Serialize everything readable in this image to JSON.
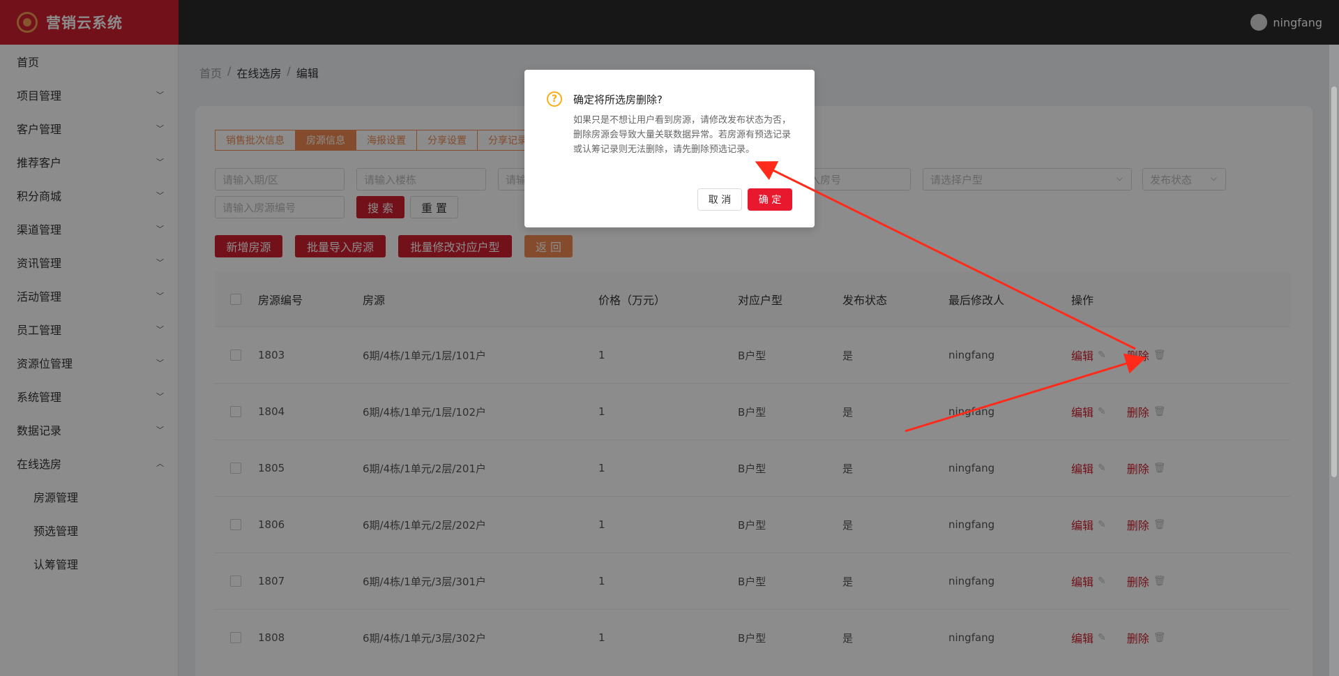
{
  "app": {
    "logo_text": "营销云系统",
    "username": "ningfang"
  },
  "sidebar": {
    "items": [
      {
        "label": "首页",
        "expandable": false
      },
      {
        "label": "项目管理",
        "expandable": true
      },
      {
        "label": "客户管理",
        "expandable": true
      },
      {
        "label": "推荐客户",
        "expandable": true
      },
      {
        "label": "积分商城",
        "expandable": true
      },
      {
        "label": "渠道管理",
        "expandable": true
      },
      {
        "label": "资讯管理",
        "expandable": true
      },
      {
        "label": "活动管理",
        "expandable": true
      },
      {
        "label": "员工管理",
        "expandable": true
      },
      {
        "label": "资源位管理",
        "expandable": true
      },
      {
        "label": "系统管理",
        "expandable": true
      },
      {
        "label": "数据记录",
        "expandable": true
      },
      {
        "label": "在线选房",
        "expandable": true,
        "expanded": true
      }
    ],
    "subitems": [
      "房源管理",
      "预选管理",
      "认筹管理"
    ]
  },
  "breadcrumb": [
    "首页",
    "在线选房",
    "编辑"
  ],
  "tabs": [
    "销售批次信息",
    "房源信息",
    "海报设置",
    "分享设置",
    "分享记录"
  ],
  "active_tab": "房源信息",
  "filters": {
    "period": "请输入期/区",
    "building": "请输入楼栋",
    "unit": "请输入单元",
    "room": "请输入房号",
    "house_type": "请选择户型",
    "status": "发布状态",
    "code": "请输入房源编号"
  },
  "buttons": {
    "search": "搜 索",
    "reset": "重 置",
    "add": "新增房源",
    "import": "批量导入房源",
    "batch_edit": "批量修改对应户型",
    "back": "返 回"
  },
  "table": {
    "headers": [
      "房源编号",
      "房源",
      "价格（万元）",
      "对应户型",
      "发布状态",
      "最后修改人",
      "操作"
    ],
    "rows": [
      [
        "1803",
        "6期/4栋/1单元/1层/101户",
        "1",
        "B户型",
        "是",
        "ningfang"
      ],
      [
        "1804",
        "6期/4栋/1单元/1层/102户",
        "1",
        "B户型",
        "是",
        "ningfang"
      ],
      [
        "1805",
        "6期/4栋/1单元/2层/201户",
        "1",
        "B户型",
        "是",
        "ningfang"
      ],
      [
        "1806",
        "6期/4栋/1单元/2层/202户",
        "1",
        "B户型",
        "是",
        "ningfang"
      ],
      [
        "1807",
        "6期/4栋/1单元/3层/301户",
        "1",
        "B户型",
        "是",
        "ningfang"
      ],
      [
        "1808",
        "6期/4栋/1单元/3层/302户",
        "1",
        "B户型",
        "是",
        "ningfang"
      ]
    ],
    "edit_label": "编辑",
    "delete_label": "删除"
  },
  "dialog": {
    "title": "确定将所选房删除?",
    "content": "如果只是不想让用户看到房源，请修改发布状态为否，删除房源会导致大量关联数据异常。若房源有预选记录或认筹记录则无法删除，请先删除预选记录。",
    "cancel": "取 消",
    "ok": "确 定"
  },
  "colors": {
    "brand_red": "#cf1f2e",
    "accent_orange": "#f08a52",
    "warning": "#faad14",
    "annotation_arrow": "#ff2a1a"
  }
}
